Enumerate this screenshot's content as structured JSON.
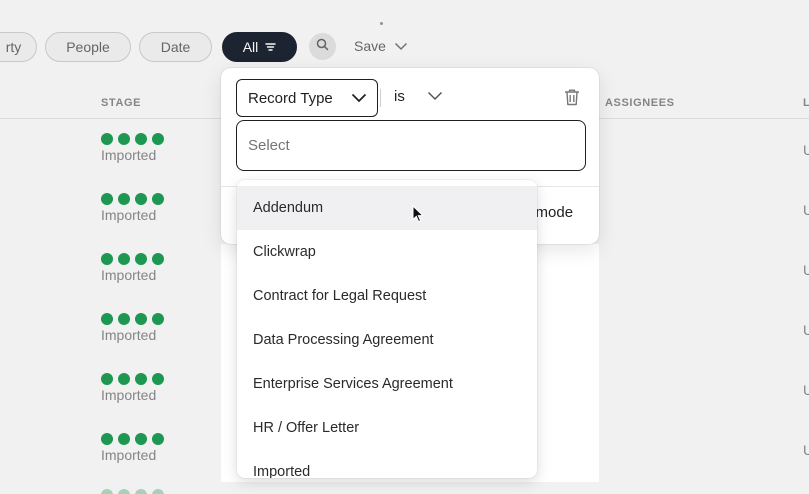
{
  "toolbar": {
    "filters": [
      {
        "label": "rty"
      },
      {
        "label": "People"
      },
      {
        "label": "Date"
      }
    ],
    "all_label": "All",
    "save_label": "Save"
  },
  "table": {
    "columns": {
      "stage": "STAGE",
      "assignees": "ASSIGNEES",
      "edge": "L"
    },
    "rows": [
      {
        "stage": "Imported",
        "edge": "U"
      },
      {
        "stage": "Imported",
        "edge": "U"
      },
      {
        "stage": "Imported",
        "edge": "U"
      },
      {
        "stage": "Imported",
        "edge": "U"
      },
      {
        "stage": "Imported",
        "edge": "U"
      },
      {
        "stage": "Imported",
        "edge": "U"
      }
    ]
  },
  "filter": {
    "field": "Record Type",
    "operator": "is",
    "value_placeholder": "Select",
    "mode_text": "d mode"
  },
  "dropdown": {
    "options": [
      "Addendum",
      "Clickwrap",
      "Contract for Legal Request",
      "Data Processing Agreement",
      "Enterprise Services Agreement",
      "HR / Offer Letter",
      "Imported"
    ],
    "hovered_index": 0
  },
  "colors": {
    "stage_dot": "#1f9d55",
    "dark_pill": "#1f2633"
  }
}
